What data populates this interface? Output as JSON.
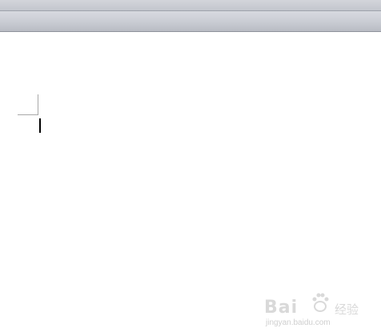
{
  "watermark": {
    "brand_text": "Bai",
    "brand_suffix": "经验",
    "url": "jingyan.baidu.com"
  },
  "colors": {
    "ribbon": "#c9ccd3",
    "page": "#ffffff",
    "margin_marker": "#a8a8a8",
    "cursor": "#000000",
    "watermark": "#d9d9d9"
  }
}
